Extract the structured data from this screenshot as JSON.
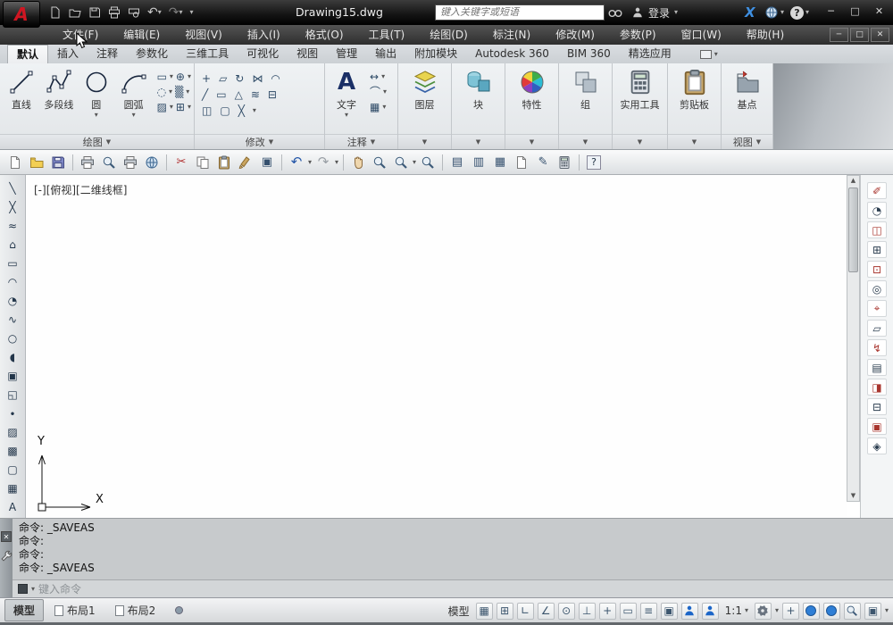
{
  "colors": {
    "brand_red": "#cf1622",
    "accent_blue": "#1c66c8"
  },
  "titlebar": {
    "title": "Drawing15.dwg",
    "search_placeholder": "键入关键字或短语",
    "login_label": "登录"
  },
  "menubar": {
    "items": [
      "文件(F)",
      "编辑(E)",
      "视图(V)",
      "插入(I)",
      "格式(O)",
      "工具(T)",
      "绘图(D)",
      "标注(N)",
      "修改(M)",
      "参数(P)",
      "窗口(W)",
      "帮助(H)"
    ]
  },
  "ribbon": {
    "tabs": [
      "默认",
      "插入",
      "注释",
      "参数化",
      "三维工具",
      "可视化",
      "视图",
      "管理",
      "输出",
      "附加模块",
      "Autodesk 360",
      "BIM 360",
      "精选应用"
    ],
    "draw_buttons": [
      "直线",
      "多段线",
      "圆",
      "圆弧"
    ],
    "text_button": "文字",
    "collapsed_buttons": [
      "图层",
      "块",
      "特性",
      "组",
      "实用工具",
      "剪贴板",
      "基点"
    ],
    "panel_labels": {
      "draw": "绘图",
      "modify": "修改",
      "annotate": "注释",
      "view": "视图"
    }
  },
  "viewport": {
    "label": "[-][俯视][二维线框]",
    "ucs_x": "X",
    "ucs_y": "Y"
  },
  "command": {
    "history": [
      "命令: _SAVEAS",
      "命令:",
      "命令:",
      "命令: _SAVEAS"
    ],
    "input_hint": "键入命令"
  },
  "statusbar": {
    "layout_tabs": [
      "模型",
      "布局1",
      "布局2"
    ],
    "model_button": "模型",
    "scale": "1:1"
  },
  "icons": {
    "logo_a": "A",
    "caret_down": "▾",
    "panel_caret": "▼",
    "win_min": "─",
    "win_max": "□",
    "win_close": "✕",
    "exchange_x": "X",
    "help_q": "?",
    "undo_arrow": "↶",
    "redo_arrow": "↷",
    "scissors": "✂",
    "scroll_up": "▲",
    "scroll_down": "▼",
    "plus": "+",
    "text_glyph": "A",
    "toolbar_extra": [
      "▣",
      "▤",
      "▥",
      "▦",
      "✎",
      "?"
    ],
    "left_toolbar": [
      "╲",
      "╳",
      "≈",
      "⌂",
      "▭",
      "◠",
      "◔",
      "∿",
      "○",
      "◖",
      "▣",
      "◱",
      "∙",
      "▨",
      "▩",
      "▢",
      "▦",
      "A"
    ],
    "draw_grid": [
      [
        "▭",
        "⊕"
      ],
      [
        "◌",
        "▒"
      ],
      [
        "▨",
        "⊞"
      ]
    ],
    "modify_grid": [
      [
        "+",
        "▱",
        "↻",
        "⋈",
        "◠"
      ],
      [
        "╱",
        "▭",
        "△",
        "≋",
        "⊟"
      ],
      [
        "◫",
        "▢",
        "╳"
      ]
    ],
    "annotate_col": [
      "↔",
      "⌒",
      "▦"
    ],
    "navbar": [
      "✐",
      "◔",
      "◫",
      "⊞",
      "⊡",
      "◎",
      "⌖",
      "▱",
      "↯",
      "▤",
      "◨",
      "⊟",
      "▣",
      "◈"
    ],
    "status_toggles": [
      "▦",
      "⊞",
      "∟",
      "∠",
      "⊙",
      "⊥",
      "+",
      "▭",
      "≡",
      "▣"
    ]
  }
}
